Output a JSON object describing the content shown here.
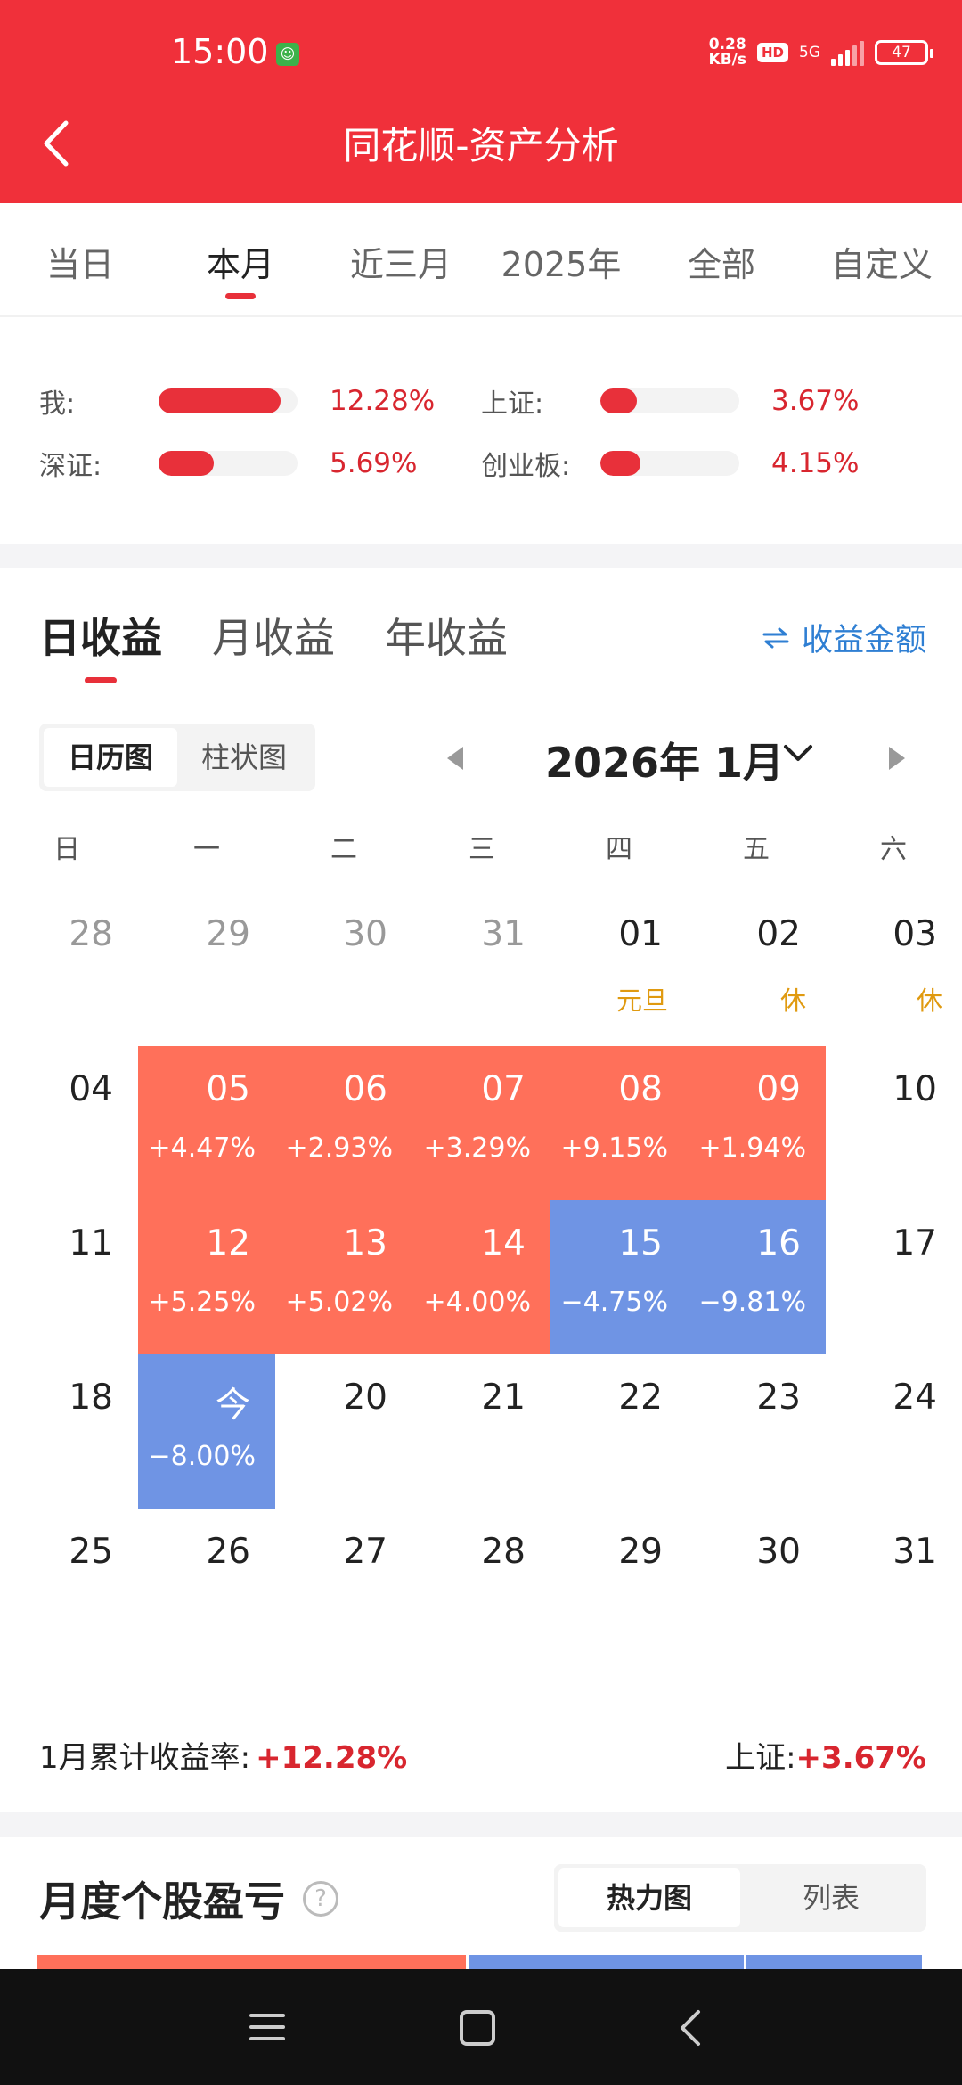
{
  "status_bar": {
    "time": "15:00",
    "speed_value": "0.28",
    "speed_unit": "KB/s",
    "hd": "HD",
    "network": "5G",
    "battery": "47"
  },
  "header": {
    "title": "同花顺-资产分析"
  },
  "period_tabs": [
    {
      "label": "当日",
      "active": false
    },
    {
      "label": "本月",
      "active": true
    },
    {
      "label": "近三月",
      "active": false
    },
    {
      "label": "2025年",
      "active": false
    },
    {
      "label": "全部",
      "active": false
    },
    {
      "label": "自定义",
      "active": false
    }
  ],
  "comparison": [
    {
      "label": "我:",
      "value": "12.28%",
      "fill": 0.88
    },
    {
      "label": "上证:",
      "value": "3.67%",
      "fill": 0.26
    },
    {
      "label": "深证:",
      "value": "5.69%",
      "fill": 0.4
    },
    {
      "label": "创业板:",
      "value": "4.15%",
      "fill": 0.29
    }
  ],
  "return_tabs": [
    {
      "label": "日收益",
      "active": true
    },
    {
      "label": "月收益",
      "active": false
    },
    {
      "label": "年收益",
      "active": false
    }
  ],
  "amount_toggle": {
    "icon": "swap-icon",
    "label": "收益金额"
  },
  "view_switch": [
    {
      "label": "日历图",
      "active": true
    },
    {
      "label": "柱状图",
      "active": false
    }
  ],
  "month_nav": {
    "label": "2026年 1月"
  },
  "weekdays": [
    "日",
    "一",
    "二",
    "三",
    "四",
    "五",
    "六"
  ],
  "calendar_weeks": [
    [
      {
        "day": "28",
        "muted": true
      },
      {
        "day": "29",
        "muted": true
      },
      {
        "day": "30",
        "muted": true
      },
      {
        "day": "31",
        "muted": true
      },
      {
        "day": "01",
        "note": "元旦"
      },
      {
        "day": "02",
        "note": "休"
      },
      {
        "day": "03",
        "note": "休"
      }
    ],
    [
      {
        "day": "04"
      },
      {
        "day": "05",
        "ret": "+4.47%",
        "dir": "up"
      },
      {
        "day": "06",
        "ret": "+2.93%",
        "dir": "up"
      },
      {
        "day": "07",
        "ret": "+3.29%",
        "dir": "up"
      },
      {
        "day": "08",
        "ret": "+9.15%",
        "dir": "up"
      },
      {
        "day": "09",
        "ret": "+1.94%",
        "dir": "up"
      },
      {
        "day": "10"
      }
    ],
    [
      {
        "day": "11"
      },
      {
        "day": "12",
        "ret": "+5.25%",
        "dir": "up"
      },
      {
        "day": "13",
        "ret": "+5.02%",
        "dir": "up"
      },
      {
        "day": "14",
        "ret": "+4.00%",
        "dir": "up"
      },
      {
        "day": "15",
        "ret": "−4.75%",
        "dir": "down"
      },
      {
        "day": "16",
        "ret": "−9.81%",
        "dir": "down"
      },
      {
        "day": "17"
      }
    ],
    [
      {
        "day": "18"
      },
      {
        "day": "今",
        "ret": "−8.00%",
        "dir": "down"
      },
      {
        "day": "20"
      },
      {
        "day": "21"
      },
      {
        "day": "22"
      },
      {
        "day": "23"
      },
      {
        "day": "24"
      }
    ],
    [
      {
        "day": "25"
      },
      {
        "day": "26"
      },
      {
        "day": "27"
      },
      {
        "day": "28"
      },
      {
        "day": "29"
      },
      {
        "day": "30"
      },
      {
        "day": "31"
      }
    ]
  ],
  "summary": {
    "left_label": "1月累计收益率:",
    "left_value": "+12.28%",
    "right_label": "上证:",
    "right_value": "+3.67%"
  },
  "stock_section": {
    "title": "月度个股盈亏",
    "help_icon": "?",
    "switch": [
      {
        "label": "热力图",
        "active": true
      },
      {
        "label": "列表",
        "active": false
      }
    ],
    "heat_segments": [
      {
        "color": "#ff705a",
        "share": 0.486
      },
      {
        "color": "#6f94e4",
        "share": 0.313
      },
      {
        "color": "#6f94e4",
        "share": 0.201
      }
    ]
  },
  "colors": {
    "brand_red": "#f0303a",
    "up": "#ff705a",
    "down": "#6f94e4",
    "holiday": "#e09a10",
    "link": "#2f7fd3"
  }
}
